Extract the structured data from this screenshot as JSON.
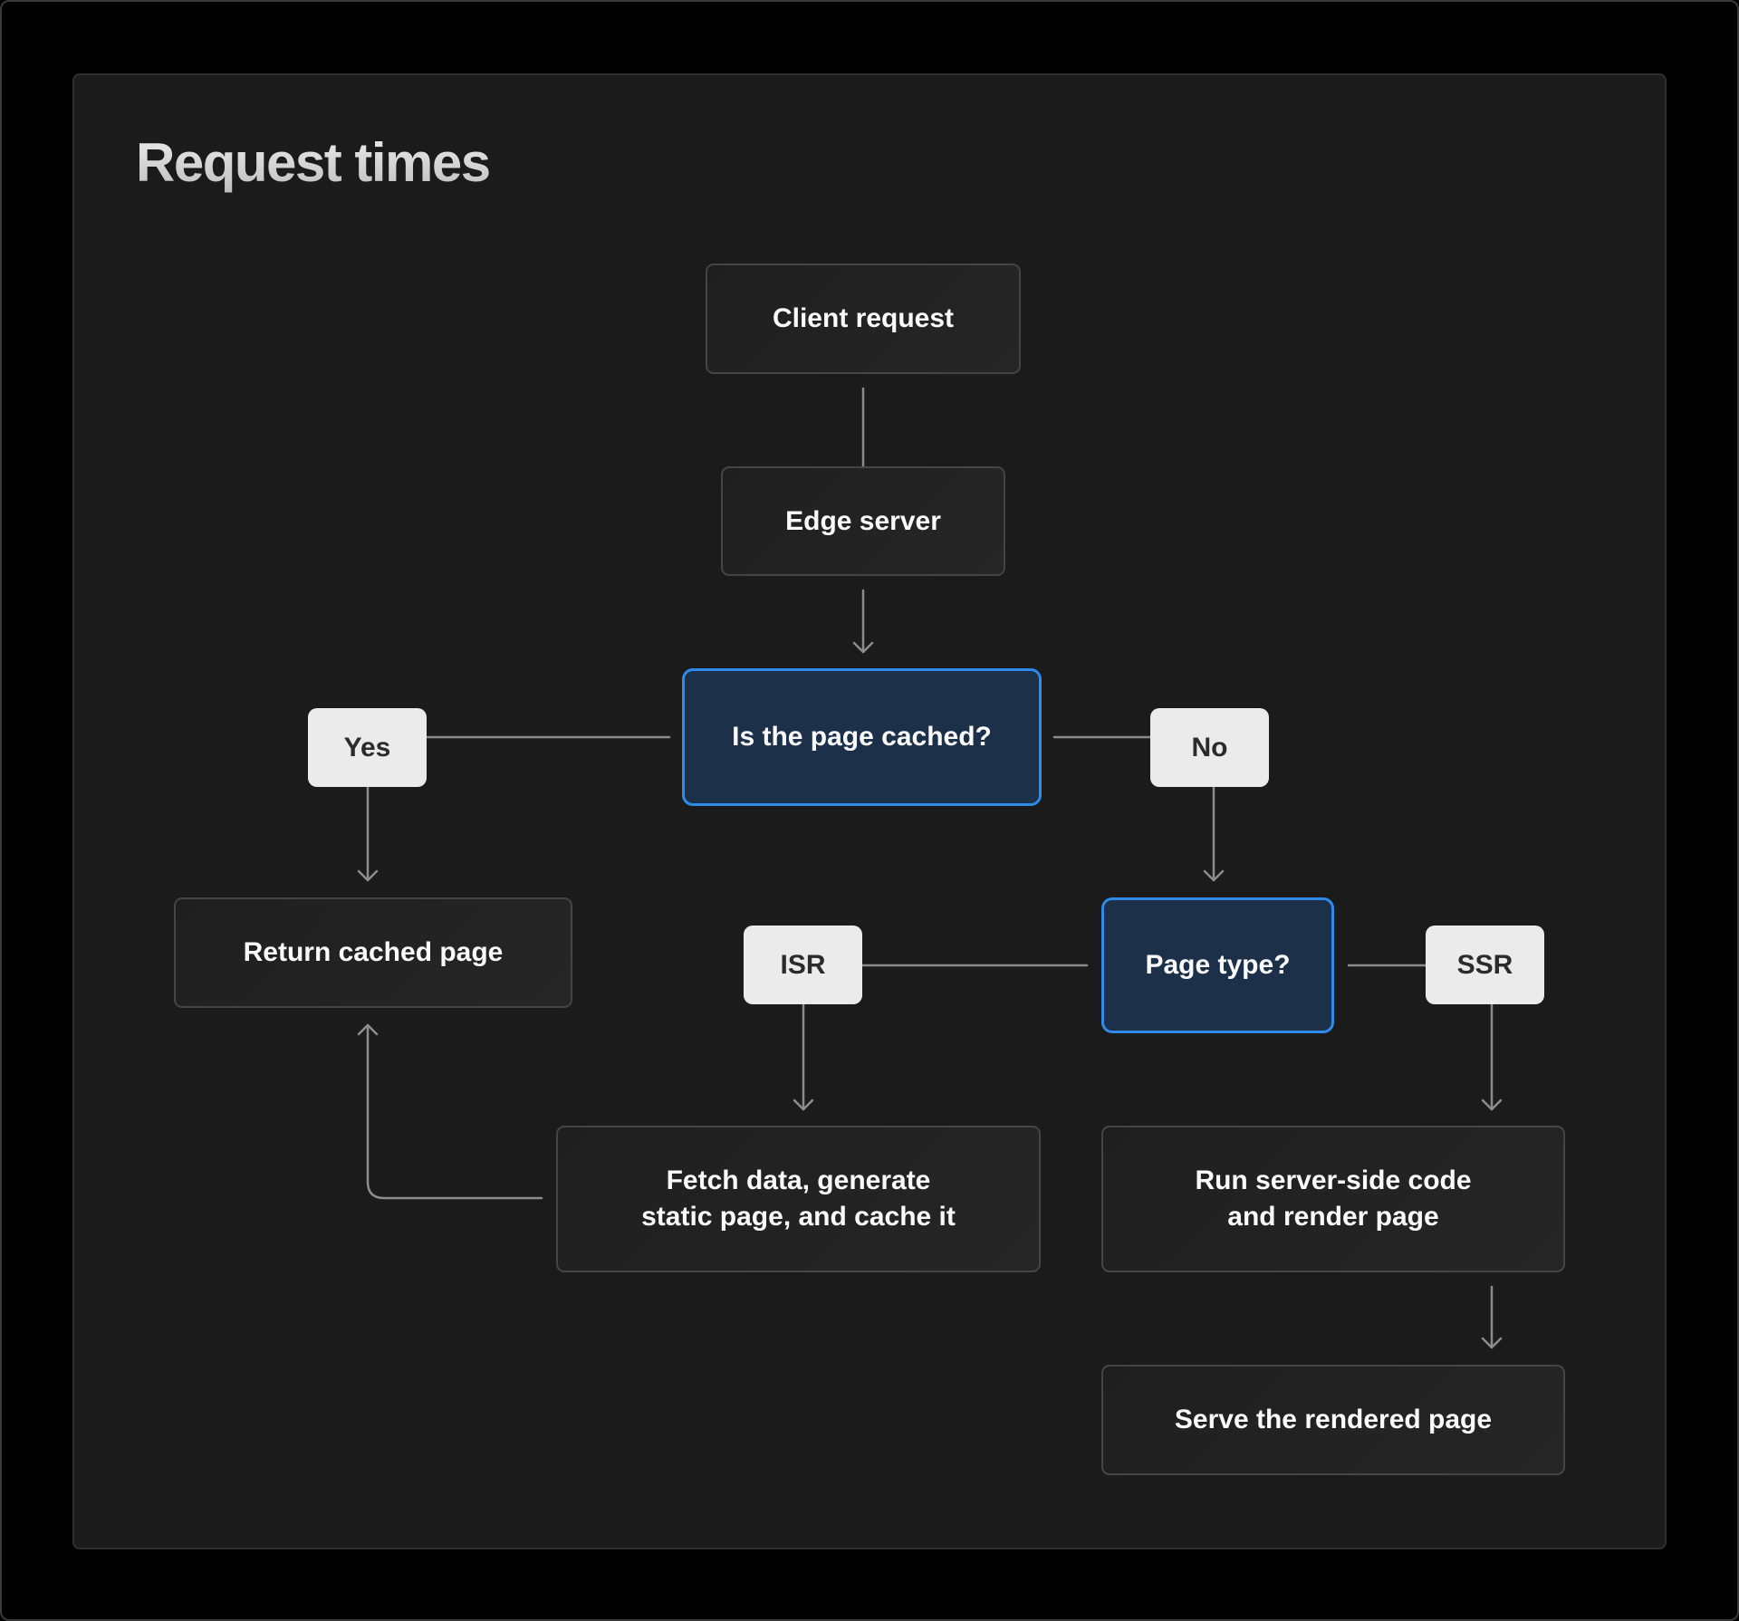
{
  "title": "Request times",
  "nodes": {
    "client_request": "Client request",
    "edge_server": "Edge server",
    "is_cached": "Is the page cached?",
    "return_cached": "Return cached page",
    "page_type": "Page type?",
    "fetch_data_line1": "Fetch data, generate",
    "fetch_data_line2": "static page, and cache it",
    "run_ssr_line1": "Run server-side code",
    "run_ssr_line2": "and render page",
    "serve_rendered": "Serve the rendered page"
  },
  "labels": {
    "yes": "Yes",
    "no": "No",
    "isr": "ISR",
    "ssr": "SSR"
  },
  "colors": {
    "decision_border": "#2f8be9",
    "decision_fill": "#1d3049",
    "connector": "#8c8c8c",
    "pill_fill": "#ebebeb"
  }
}
